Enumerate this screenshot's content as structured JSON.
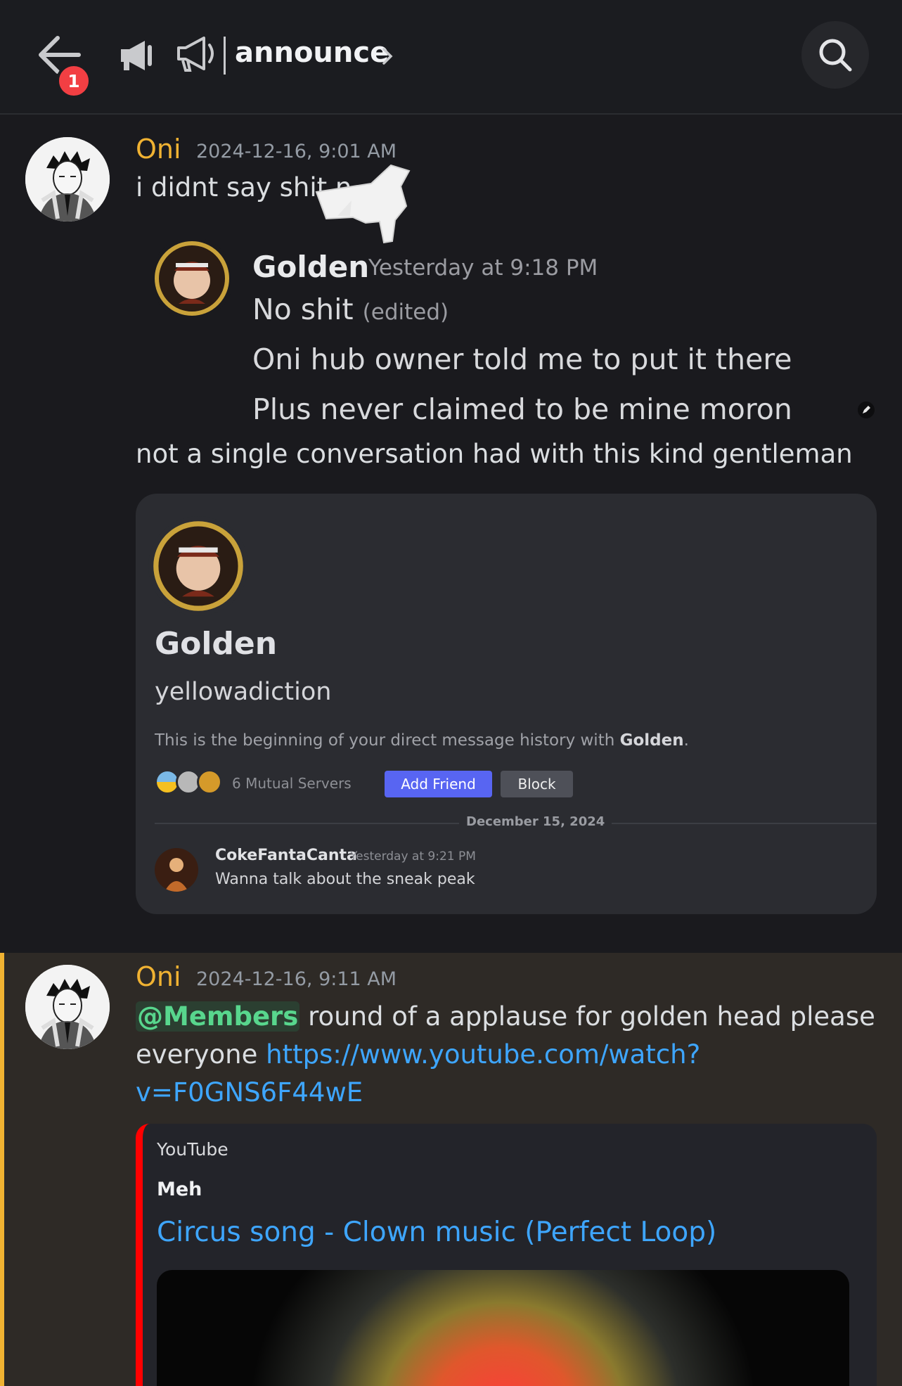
{
  "header": {
    "notification_count": "1",
    "channel_name": "announce"
  },
  "messages": [
    {
      "author": "Oni",
      "timestamp": "2024-12-16, 9:01 AM",
      "text": "i didnt say shit n",
      "quote": {
        "author": "Golden",
        "timestamp": "Yesterday at 9:18 PM",
        "line1": "No shit",
        "edited": "(edited)",
        "line2": "Oni hub owner told me to put it there",
        "line3": "Plus never claimed to be mine moron"
      },
      "text2": "not a single conversation had with this kind gentleman",
      "profile_card": {
        "name": "Golden",
        "username": "yellowadiction",
        "description_prefix": "This is the beginning of your direct message history with ",
        "description_name": "Golden",
        "description_suffix": ".",
        "mutual_servers": "6 Mutual Servers",
        "add_friend_label": "Add Friend",
        "block_label": "Block",
        "date_separator": "December 15, 2024",
        "dm": {
          "author": "CokeFantaCanta",
          "timestamp": "Yesterday at 9:21 PM",
          "text": "Wanna talk about the sneak peak"
        }
      }
    },
    {
      "author": "Oni",
      "timestamp": "2024-12-16, 9:11 AM",
      "mention": "@Members",
      "text_a": " round of a applause for golden head please",
      "text_b": "everyone ",
      "link_part1": "https://www.youtube.com/watch?",
      "link_part2": "v=F0GNS6F44wE",
      "embed": {
        "provider": "YouTube",
        "author": "Meh",
        "title": "Circus song - Clown music (Perfect Loop)"
      }
    }
  ],
  "colors": {
    "author": "#f0b232",
    "mention": "#58d68d",
    "link": "#3ea6ff",
    "accent_button": "#5865f2",
    "embed_bar": "#ff0000"
  },
  "icons": [
    "back-arrow-icon",
    "megaphone-icon",
    "announcement-channel-icon",
    "chevron-right-icon",
    "search-icon"
  ]
}
